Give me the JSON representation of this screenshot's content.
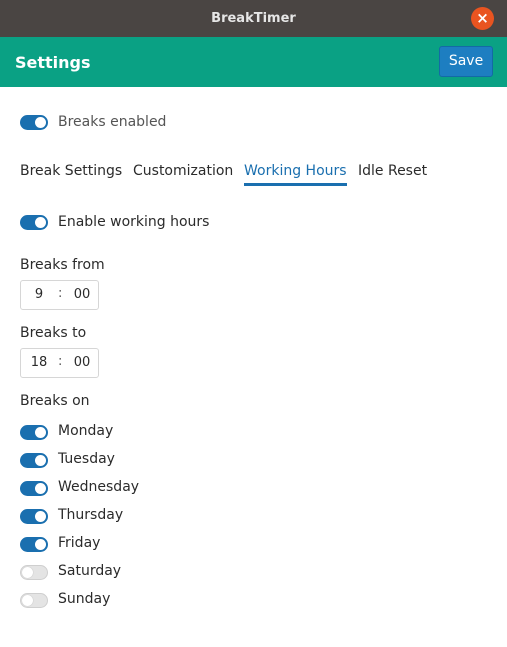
{
  "window": {
    "title": "BreakTimer",
    "close_icon": "close-icon"
  },
  "header": {
    "title": "Settings",
    "save_label": "Save"
  },
  "breaks_enabled": {
    "label": "Breaks enabled",
    "on": true
  },
  "tabs": [
    {
      "label": "Break Settings",
      "active": false
    },
    {
      "label": "Customization",
      "active": false
    },
    {
      "label": "Working Hours",
      "active": true
    },
    {
      "label": "Idle Reset",
      "active": false
    }
  ],
  "working_hours": {
    "enable_label": "Enable working hours",
    "enabled": true,
    "from_label": "Breaks from",
    "from": {
      "hours": "9",
      "minutes": "00"
    },
    "to_label": "Breaks to",
    "to": {
      "hours": "18",
      "minutes": "00"
    },
    "separator": ":",
    "days_label": "Breaks on",
    "days": [
      {
        "label": "Monday",
        "on": true
      },
      {
        "label": "Tuesday",
        "on": true
      },
      {
        "label": "Wednesday",
        "on": true
      },
      {
        "label": "Thursday",
        "on": true
      },
      {
        "label": "Friday",
        "on": true
      },
      {
        "label": "Saturday",
        "on": false
      },
      {
        "label": "Sunday",
        "on": false
      }
    ]
  },
  "colors": {
    "titlebar": "#4a4543",
    "header": "#0aa184",
    "accent": "#1a6faf",
    "close": "#e95420"
  }
}
